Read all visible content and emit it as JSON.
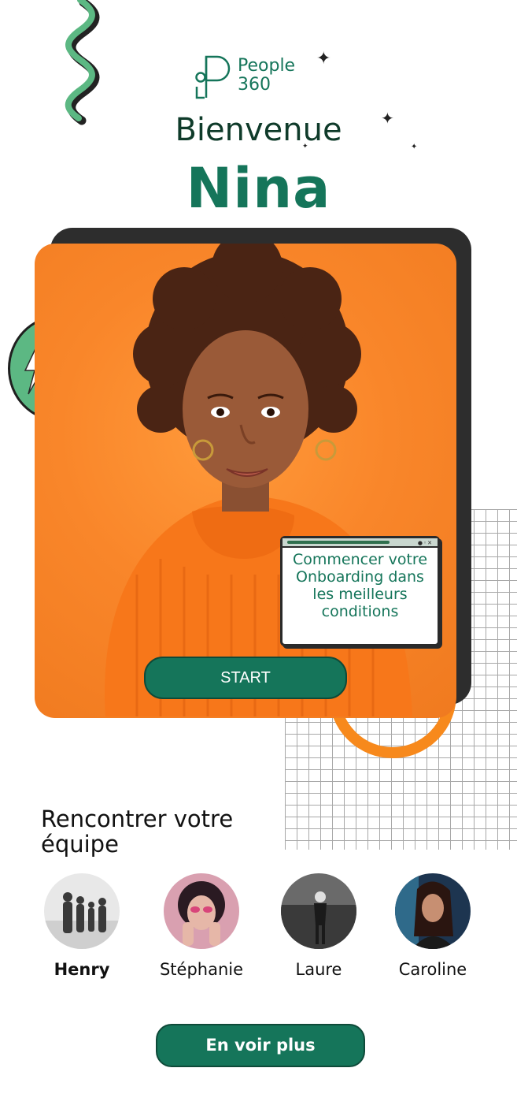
{
  "logo": {
    "line1": "People",
    "line2": "360"
  },
  "welcome": "Bienvenue",
  "user_name": "Nina",
  "popup": {
    "text": "Commencer votre Onboarding dans les meilleurs conditions"
  },
  "start_label": "START",
  "team": {
    "title": "Rencontrer votre équipe",
    "members": [
      {
        "name": "Henry"
      },
      {
        "name": "Stéphanie"
      },
      {
        "name": "Laure"
      },
      {
        "name": "Caroline"
      }
    ]
  },
  "more_label": "En voir plus",
  "colors": {
    "brand_green": "#15755a",
    "accent_orange": "#f7891c",
    "dark": "#2d2d2d"
  }
}
